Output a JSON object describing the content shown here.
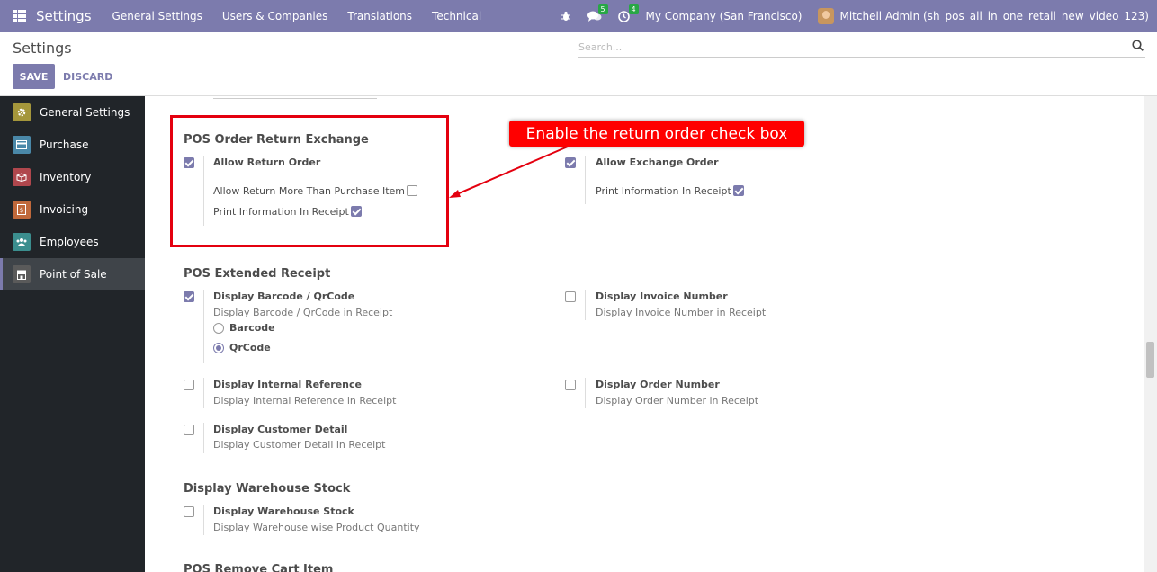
{
  "navbar": {
    "brand": "Settings",
    "menu": [
      "General Settings",
      "Users & Companies",
      "Translations",
      "Technical"
    ],
    "messages_count": "5",
    "activities_count": "4",
    "company": "My Company (San Francisco)",
    "user": "Mitchell Admin (sh_pos_all_in_one_retail_new_video_123)"
  },
  "control_panel": {
    "title": "Settings",
    "search_placeholder": "Search...",
    "save_label": "SAVE",
    "discard_label": "DISCARD"
  },
  "sidebar": {
    "items": [
      {
        "label": "General Settings",
        "color": "#a4963b"
      },
      {
        "label": "Purchase",
        "color": "#4a88a8"
      },
      {
        "label": "Inventory",
        "color": "#b0474d"
      },
      {
        "label": "Invoicing",
        "color": "#c0693b"
      },
      {
        "label": "Employees",
        "color": "#3b8e8e"
      },
      {
        "label": "Point of Sale",
        "color": "#5a5a5a"
      }
    ],
    "active": "Point of Sale"
  },
  "sections": {
    "return_exchange": {
      "title": "POS Order Return Exchange",
      "allow_return": {
        "label": "Allow Return Order",
        "checked": true
      },
      "allow_more": {
        "label": "Allow Return More Than Purchase Item",
        "checked": false
      },
      "print_return": {
        "label": "Print Information In Receipt",
        "checked": true
      },
      "allow_exchange": {
        "label": "Allow Exchange Order",
        "checked": true
      },
      "print_exchange": {
        "label": "Print Information In Receipt",
        "checked": true
      }
    },
    "extended_receipt": {
      "title": "POS Extended Receipt",
      "barcode": {
        "label": "Display Barcode / QrCode",
        "desc": "Display Barcode / QrCode in Receipt",
        "checked": true
      },
      "barcode_options": [
        {
          "label": "Barcode",
          "selected": false
        },
        {
          "label": "QrCode",
          "selected": true
        }
      ],
      "invoice_number": {
        "label": "Display Invoice Number",
        "desc": "Display Invoice Number in Receipt",
        "checked": false
      },
      "internal_ref": {
        "label": "Display Internal Reference",
        "desc": "Display Internal Reference in Receipt",
        "checked": false
      },
      "order_number": {
        "label": "Display Order Number",
        "desc": "Display Order Number in Receipt",
        "checked": false
      },
      "customer_detail": {
        "label": "Display Customer Detail",
        "desc": "Display Customer Detail in Receipt",
        "checked": false
      }
    },
    "warehouse": {
      "title": "Display Warehouse Stock",
      "stock": {
        "label": "Display Warehouse Stock",
        "desc": "Display Warehouse wise Product Quantity",
        "checked": false
      }
    },
    "remove_cart": {
      "title": "POS Remove Cart Item"
    }
  },
  "annotation": {
    "callout": "Enable the return order check box",
    "color": "#ff0000"
  },
  "colors": {
    "primary": "#7c7bad",
    "sidebar_bg": "#212529"
  }
}
